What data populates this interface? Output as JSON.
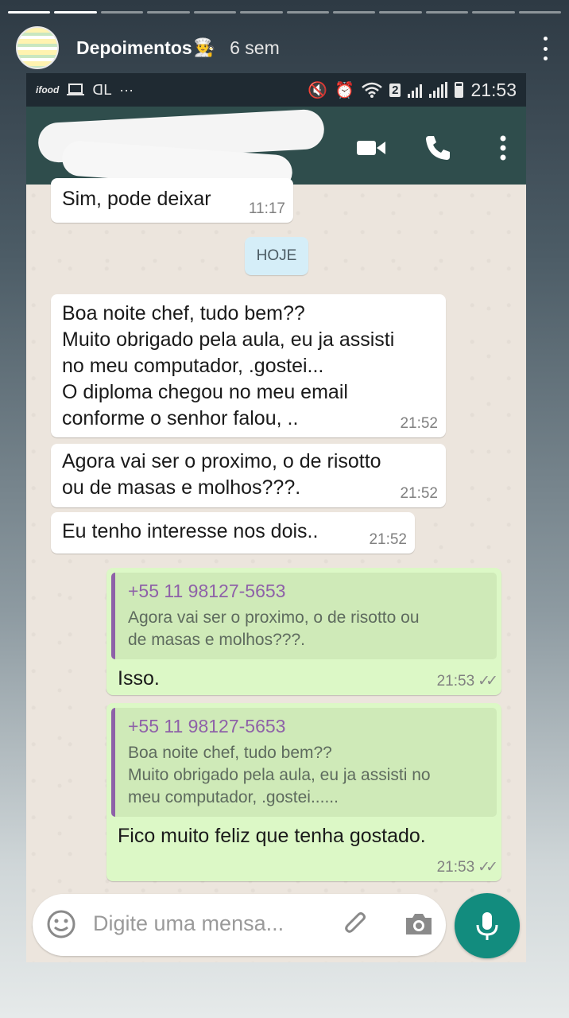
{
  "story": {
    "title": "Depoimentos",
    "emoji": "👨‍🍳",
    "age": "6 sem",
    "progress_segments": 12,
    "progress_done": 1
  },
  "status_bar": {
    "left_label": "ifood",
    "sim_badge": "2",
    "time": "21:53"
  },
  "chat": {
    "date_divider": "HOJE",
    "messages": [
      {
        "direction": "in",
        "text": "Sim, pode deixar",
        "time": "11:17"
      },
      {
        "direction": "in",
        "text": "Boa noite chef, tudo bem??\nMuito obrigado pela aula, eu ja assisti\nno meu computador, .gostei...\nO diploma chegou no meu email\nconforme o senhor falou,  ..",
        "time": "21:52"
      },
      {
        "direction": "in",
        "text": "Agora vai ser o proximo, o de risotto\nou de masas e molhos???.",
        "time": "21:52"
      },
      {
        "direction": "in",
        "text": "Eu tenho interesse nos dois..",
        "time": "21:52"
      },
      {
        "direction": "out",
        "quote_name": "+55 11 98127-5653",
        "quote_text": "Agora vai ser o proximo, o de risotto ou\nde masas e molhos???.",
        "text": "Isso.",
        "time": "21:53"
      },
      {
        "direction": "out",
        "quote_name": "+55 11 98127-5653",
        "quote_text": "Boa noite chef, tudo bem??\nMuito obrigado pela aula, eu ja assisti no\nmeu computador, .gostei......",
        "text": "Fico muito feliz que tenha gostado.",
        "time": "21:53"
      }
    ]
  },
  "composer": {
    "placeholder": "Digite uma mensa..."
  },
  "colors": {
    "header": "#2f4d4c",
    "outgoing": "#dcf8c6",
    "mic": "#128c7e",
    "quote_name": "#8e61a8"
  },
  "icons": [
    "emoji-icon",
    "clip-icon",
    "camera-icon",
    "mic-icon",
    "video-call-icon",
    "phone-icon",
    "more-icon",
    "back-arrow-icon"
  ]
}
